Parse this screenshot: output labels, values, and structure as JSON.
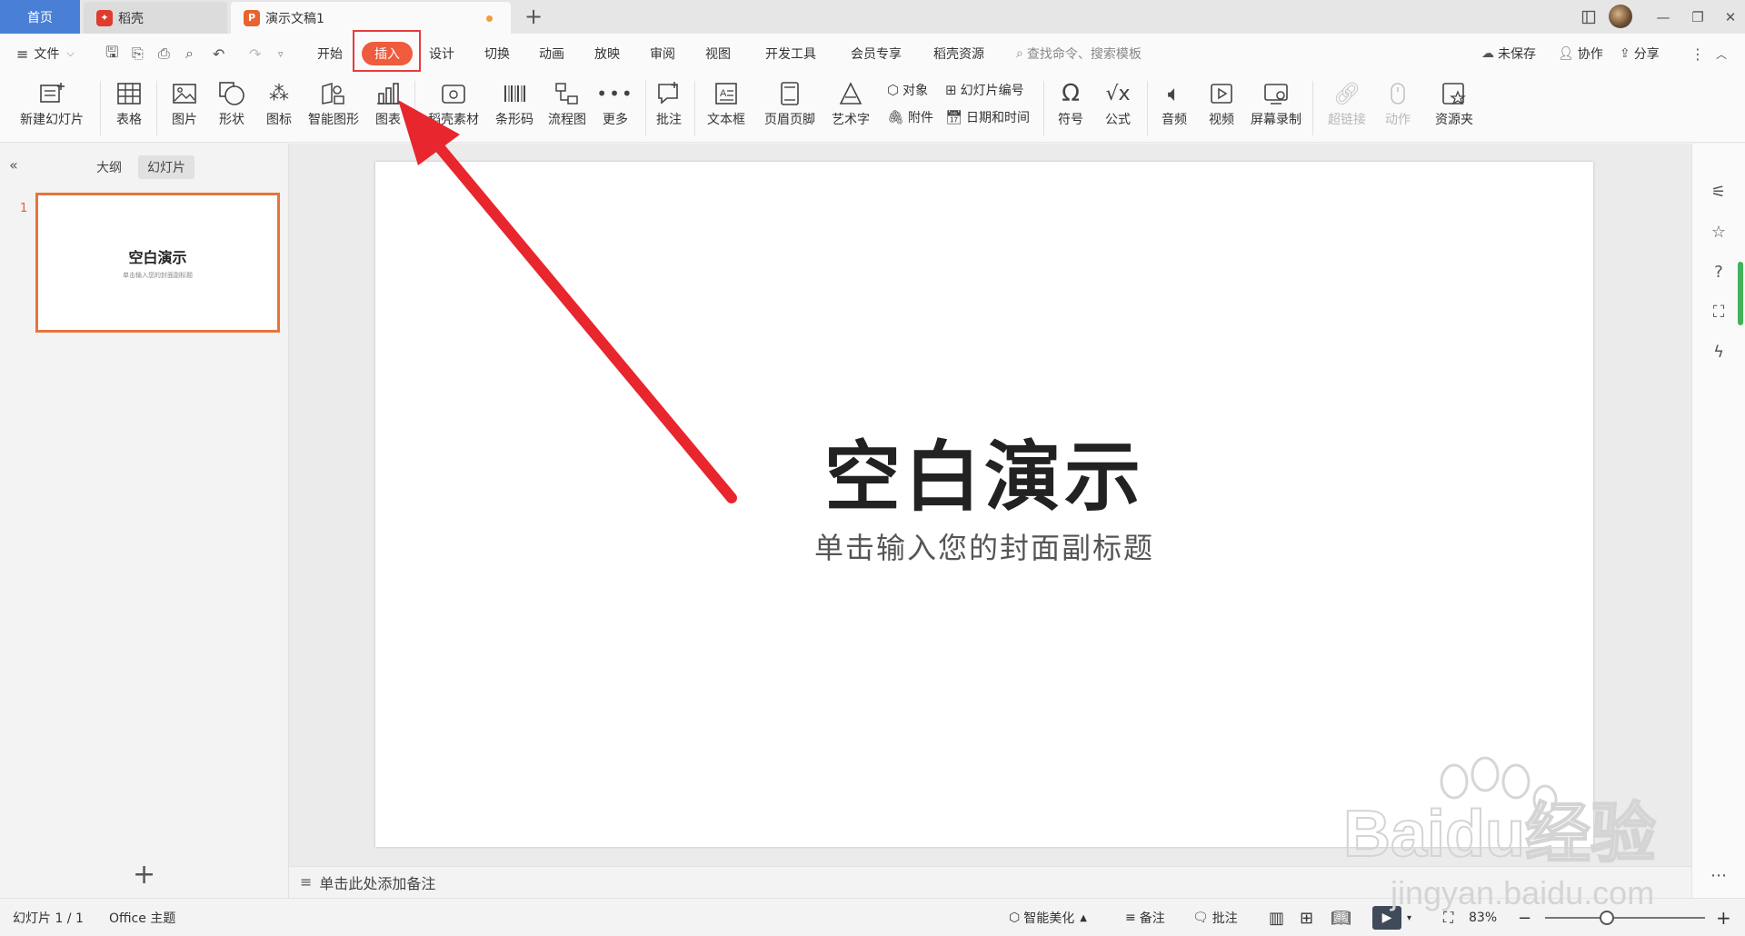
{
  "tabs": {
    "home": "首页",
    "daoke": "稻壳",
    "doc": "演示文稿1",
    "add": "+"
  },
  "menu": {
    "file": "文件",
    "items": [
      "开始",
      "插入",
      "设计",
      "切换",
      "动画",
      "放映",
      "审阅",
      "视图",
      "开发工具",
      "会员专享",
      "稻壳资源"
    ],
    "active": "插入",
    "search_placeholder": "查找命令、搜索模板",
    "unsaved": "未保存",
    "collab": "协作",
    "share": "分享"
  },
  "ribbon": {
    "new_slide": "新建幻灯片",
    "table": "表格",
    "picture": "图片",
    "shape": "形状",
    "icon": "图标",
    "smart_graphic": "智能图形",
    "chart": "图表",
    "material": "稻壳素材",
    "barcode": "条形码",
    "flowchart": "流程图",
    "more": "更多",
    "comment": "批注",
    "textbox": "文本框",
    "header_footer": "页眉页脚",
    "wordart": "艺术字",
    "object": "对象",
    "attachment": "附件",
    "slide_number": "幻灯片编号",
    "datetime": "日期和时间",
    "symbol": "符号",
    "formula": "公式",
    "audio": "音频",
    "video": "视频",
    "screen_record": "屏幕录制",
    "hyperlink": "超链接",
    "action": "动作",
    "resource": "资源夹"
  },
  "left_panel": {
    "tab_outline": "大纲",
    "tab_slides": "幻灯片",
    "slide_number": "1",
    "thumb_title": "空白演示",
    "thumb_subtitle": "单击输入您的封面副标题",
    "add": "+"
  },
  "slide": {
    "title": "空白演示",
    "subtitle": "单击输入您的封面副标题"
  },
  "notes": {
    "placeholder": "单击此处添加备注"
  },
  "status": {
    "slide_info": "幻灯片 1 / 1",
    "theme": "Office 主题",
    "beautify": "智能美化",
    "notes": "备注",
    "comments": "批注",
    "zoom": "83%"
  },
  "watermark": {
    "brand": "Baidu经验",
    "url": "jingyan.baidu.com"
  },
  "colors": {
    "accent": "#ef5b3c",
    "home_tab": "#4a7fd6",
    "arrow": "#e8262d",
    "thumb_border": "#e8743b"
  }
}
